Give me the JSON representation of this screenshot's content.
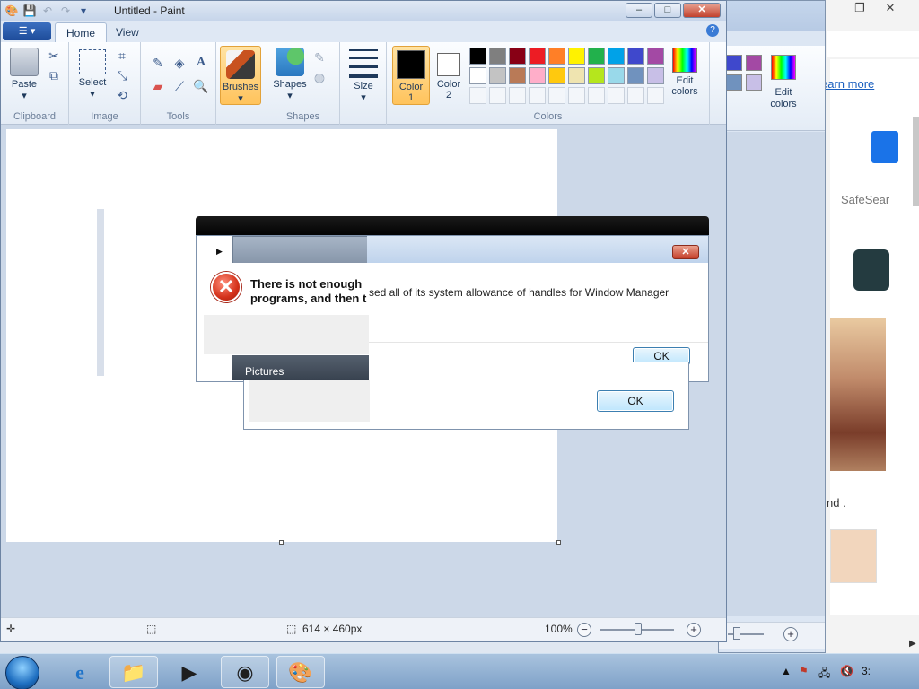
{
  "paint": {
    "title": "Untitled - Paint",
    "tabs": [
      "Home",
      "View"
    ],
    "file_menu": "▾",
    "groups": {
      "clipboard": "Clipboard",
      "image": "Image",
      "tools": "Tools",
      "shapes": "Shapes",
      "colors": "Colors"
    },
    "buttons": {
      "paste": "Paste",
      "select": "Select",
      "brushes": "Brushes",
      "shapes": "Shapes",
      "size": "Size",
      "color1_a": "Color",
      "color1_b": "1",
      "color2_a": "Color",
      "color2_b": "2",
      "edit_colors_a": "Edit",
      "edit_colors_b": "colors"
    },
    "palette": [
      "#000000",
      "#7f7f7f",
      "#880015",
      "#ed1c24",
      "#ff7f27",
      "#fff200",
      "#22b14c",
      "#00a2e8",
      "#3f48cc",
      "#a349a4",
      "#ffffff",
      "#c3c3c3",
      "#b97a57",
      "#ffaec9",
      "#ffc90e",
      "#efe4b0",
      "#b5e61d",
      "#99d9ea",
      "#7092be",
      "#c8bfe7"
    ],
    "color1": "#000000",
    "color2": "#ffffff",
    "status": {
      "dimensions": "614 × 460px",
      "zoom": "100%"
    }
  },
  "paint2": {
    "buttons": {
      "edit_colors_a": "Edit",
      "edit_colors_b": "colors"
    },
    "swatches": [
      "#3f48cc",
      "#a349a4",
      "#7092be",
      "#c8bfe7"
    ]
  },
  "browser": {
    "learn_more": "earn more",
    "safesearch": "SafeSear",
    "fragment": "nd ."
  },
  "dialog_main": {
    "message_bold_line1": "There is not enough",
    "message_bold_line2": "programs, and then t",
    "message_tail": "sed all of its system allowance of handles for Window Manager",
    "ok_label": "OK",
    "close_label": "✕"
  },
  "dialog_pictures": {
    "title": "Pictures",
    "ok_label": "OK"
  },
  "taskbar": {
    "apps": [
      "Internet Explorer",
      "Windows Explorer",
      "Windows Media Player",
      "Google Chrome",
      "Paint"
    ],
    "clock": "3:"
  }
}
